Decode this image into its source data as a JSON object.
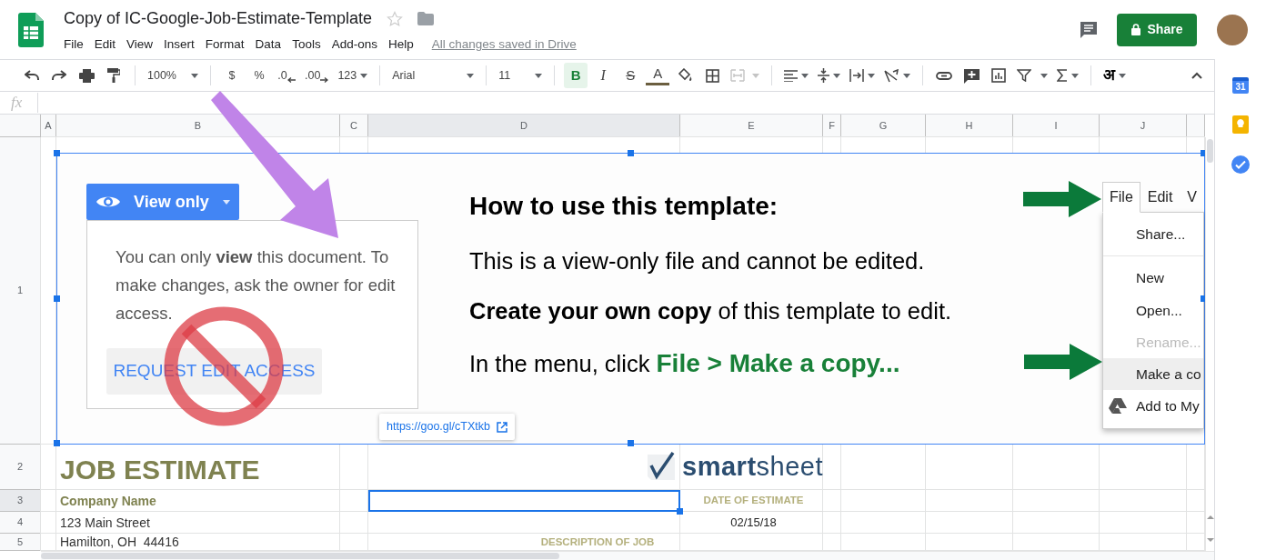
{
  "document": {
    "title": "Copy of IC-Google-Job-Estimate-Template",
    "starred": false,
    "menu": [
      "File",
      "Edit",
      "View",
      "Insert",
      "Format",
      "Data",
      "Tools",
      "Add-ons",
      "Help"
    ],
    "save_status": "All changes saved in Drive",
    "share_label": "Share"
  },
  "toolbar": {
    "zoom": "100%",
    "currency": "$",
    "percent": "%",
    "decrease_decimals": ".0",
    "increase_decimals": ".00",
    "more_formats": "123",
    "font": "Arial",
    "font_size": "11",
    "bold": "B",
    "bold_on": true,
    "italic": "I",
    "strikethrough": "S",
    "text_color": "A",
    "merge_disabled": true,
    "input_tools": "अ"
  },
  "formula_bar": {
    "label": "fx"
  },
  "columns": [
    {
      "label": "A",
      "selected": false
    },
    {
      "label": "B",
      "selected": false
    },
    {
      "label": "C",
      "selected": false
    },
    {
      "label": "D",
      "selected": true
    },
    {
      "label": "E",
      "selected": false
    },
    {
      "label": "F",
      "selected": false
    },
    {
      "label": "G",
      "selected": false
    },
    {
      "label": "H",
      "selected": false
    },
    {
      "label": "I",
      "selected": false
    },
    {
      "label": "J",
      "selected": false
    }
  ],
  "rows": [
    {
      "label": "1",
      "selected": false
    },
    {
      "label": "2",
      "selected": false
    },
    {
      "label": "3",
      "selected": true
    },
    {
      "label": "4",
      "selected": false
    },
    {
      "label": "5",
      "selected": false
    }
  ],
  "embedded_image": {
    "view_only_label": "View only",
    "message": "You can only **view** this document. To make changes, ask the owner for edit access.",
    "request_button": "REQUEST EDIT ACCESS",
    "heading": "How to use this template:",
    "lines": [
      {
        "text": "This is a view-only file and cannot be edited."
      },
      {
        "text": "**Create your own copy** of this template to edit."
      },
      {
        "text": "In the menu, click ",
        "highlight": "File > Make a copy..."
      }
    ],
    "menu_tabs": [
      {
        "label": "File",
        "selected": true
      },
      {
        "label": "Edit",
        "selected": false
      },
      {
        "label": "V",
        "selected": false
      }
    ],
    "menu_items": [
      {
        "label": "Share...",
        "disabled": false,
        "highlighted": false,
        "kind": "plain"
      },
      {
        "label": "New",
        "disabled": false,
        "highlighted": false,
        "kind": "plain"
      },
      {
        "label": "Open...",
        "disabled": false,
        "highlighted": false,
        "kind": "plain"
      },
      {
        "label": "Rename...",
        "disabled": true,
        "highlighted": false,
        "kind": "plain"
      },
      {
        "label": "Make a co",
        "disabled": false,
        "highlighted": true,
        "kind": "plain"
      },
      {
        "label": "Add to My",
        "disabled": false,
        "highlighted": false,
        "kind": "drive"
      }
    ]
  },
  "link_preview": "https://goo.gl/cTXtkb",
  "cells": [
    {
      "kind": "title",
      "text": "JOB ESTIMATE"
    },
    {
      "kind": "logo",
      "text": "**smart**sheet"
    },
    {
      "kind": "label",
      "text": "Company Name"
    },
    {
      "kind": "empty",
      "selected": true
    },
    {
      "kind": "header",
      "text": "DATE OF ESTIMATE"
    },
    {
      "kind": "plain",
      "text": "123 Main Street"
    },
    {
      "kind": "value",
      "text": "02/15/18"
    },
    {
      "kind": "plain",
      "text": "Hamilton, OH  44416"
    },
    {
      "kind": "header_wide",
      "text": "DESCRIPTION OF JOB"
    }
  ],
  "side_panel": {
    "calendar_day": "31"
  }
}
